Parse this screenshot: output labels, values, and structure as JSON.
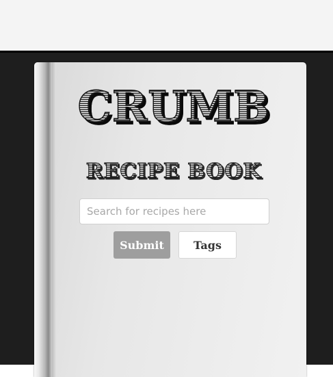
{
  "app": {
    "title": "CRUMB",
    "subtitle": "RECIPE BOOK"
  },
  "search": {
    "placeholder": "Search for recipes here",
    "value": ""
  },
  "buttons": {
    "submit_label": "Submit",
    "tags_label": "Tags"
  },
  "colors": {
    "top_bar": "#f4f4f4",
    "backdrop": "#1e1e1e",
    "book_cover": "#e7e7e7",
    "submit_button": "#9e9e9e",
    "tags_button": "#ffffff"
  }
}
